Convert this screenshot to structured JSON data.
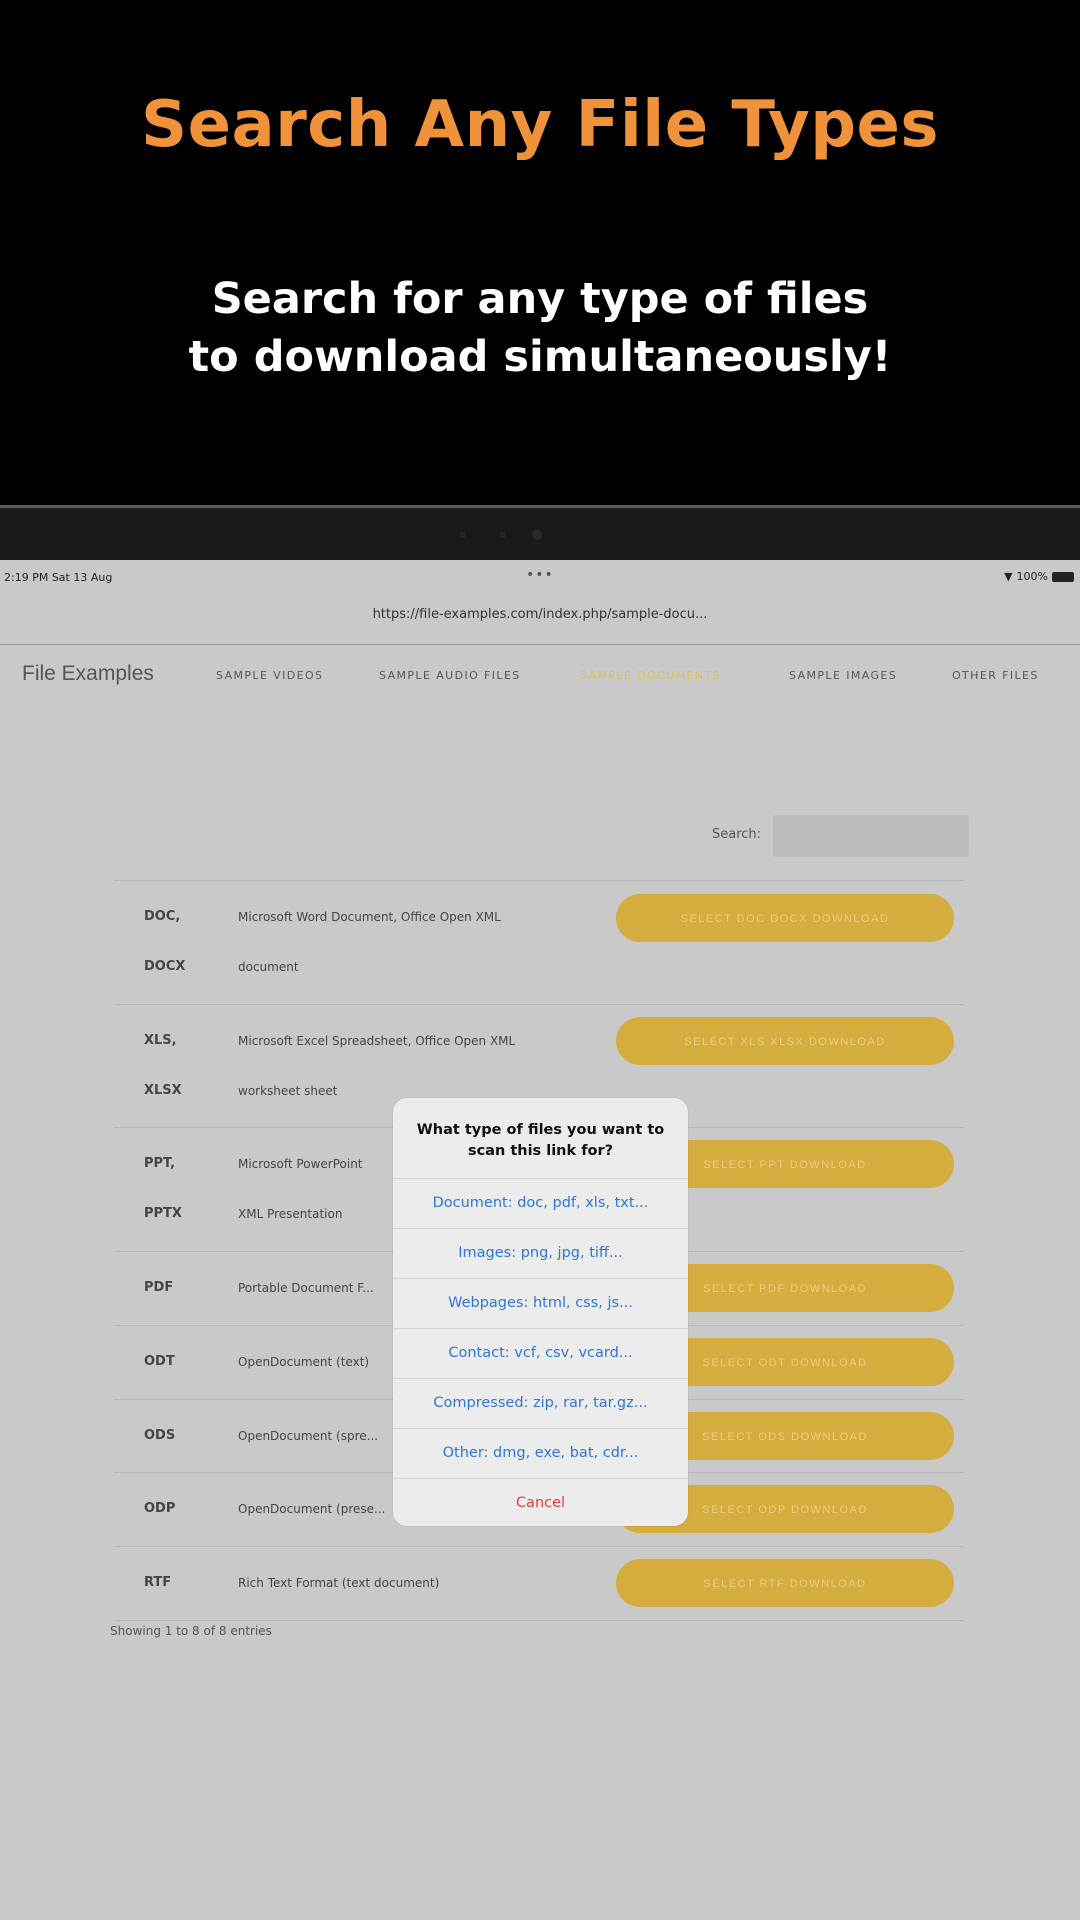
{
  "promo": {
    "title": "Search Any File Types",
    "subtitle_line1": "Search for any type of files",
    "subtitle_line2": "to download simultaneously!"
  },
  "status_bar": {
    "time": "2:19 PM  Sat 13 Aug",
    "battery": "100%"
  },
  "browser": {
    "url": "https://file-examples.com/index.php/sample-docu..."
  },
  "site": {
    "brand": "File Examples",
    "nav": [
      "SAMPLE VIDEOS",
      "SAMPLE AUDIO FILES",
      "SAMPLE DOCUMENTS",
      "SAMPLE IMAGES",
      "OTHER FILES"
    ],
    "search_label": "Search:"
  },
  "table": {
    "rows": [
      {
        "ext1": "DOC,",
        "ext2": "DOCX",
        "desc1": "Microsoft Word Document, Office Open XML",
        "desc2": "document",
        "button": "SELECT DOC DOCX DOWNLOAD"
      },
      {
        "ext1": "XLS,",
        "ext2": "XLSX",
        "desc1": "Microsoft Excel Spreadsheet, Office Open XML",
        "desc2": "worksheet sheet",
        "button": "SELECT XLS XLSX DOWNLOAD"
      },
      {
        "ext1": "PPT,",
        "ext2": "PPTX",
        "desc1": "Microsoft PowerPoint",
        "desc2": "XML Presentation",
        "button": "SELECT PPT DOWNLOAD"
      },
      {
        "ext1": "PDF",
        "desc1": "Portable Document F...",
        "button": "SELECT PDF DOWNLOAD"
      },
      {
        "ext1": "ODT",
        "desc1": "OpenDocument (text)",
        "button": "SELECT ODT DOWNLOAD"
      },
      {
        "ext1": "ODS",
        "desc1": "OpenDocument (spre...",
        "button": "SELECT ODS DOWNLOAD"
      },
      {
        "ext1": "ODP",
        "desc1": "OpenDocument (prese...",
        "button": "SELECT ODP DOWNLOAD"
      },
      {
        "ext1": "RTF",
        "desc1": "Rich Text Format (text document)",
        "button": "SELECT RTF DOWNLOAD"
      }
    ],
    "footer": "Showing 1 to 8 of 8 entries"
  },
  "action_sheet": {
    "title_line1": "What type of files you want to",
    "title_line2": "scan this link for?",
    "options": [
      "Document: doc, pdf, xls, txt...",
      "Images: png, jpg, tiff...",
      "Webpages: html, css, js...",
      "Contact: vcf, csv, vcard...",
      "Compressed: zip, rar, tar.gz...",
      "Other: dmg, exe, bat, cdr..."
    ],
    "cancel": "Cancel"
  }
}
